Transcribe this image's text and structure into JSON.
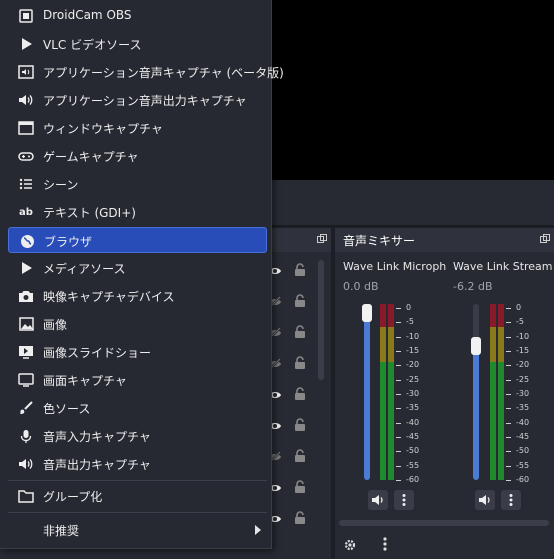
{
  "menu": {
    "items": [
      {
        "label": "DroidCam OBS",
        "icon": "droidcam-icon"
      },
      {
        "label": "VLC ビデオソース",
        "icon": "play-icon"
      },
      {
        "label": "アプリケーション音声キャプチャ (ベータ版)",
        "icon": "app-audio-capture-icon"
      },
      {
        "label": "アプリケーション音声出力キャプチャ",
        "icon": "speaker-icon"
      },
      {
        "label": "ウィンドウキャプチャ",
        "icon": "window-icon"
      },
      {
        "label": "ゲームキャプチャ",
        "icon": "gamepad-icon"
      },
      {
        "label": "シーン",
        "icon": "list-icon"
      },
      {
        "label": "テキスト (GDI+)",
        "icon": "text-icon"
      },
      {
        "label": "ブラウザ",
        "icon": "globe-icon"
      },
      {
        "label": "メディアソース",
        "icon": "play-icon"
      },
      {
        "label": "映像キャプチャデバイス",
        "icon": "camera-icon"
      },
      {
        "label": "画像",
        "icon": "image-icon"
      },
      {
        "label": "画像スライドショー",
        "icon": "slideshow-icon"
      },
      {
        "label": "画面キャプチャ",
        "icon": "monitor-icon"
      },
      {
        "label": "色ソース",
        "icon": "brush-icon"
      },
      {
        "label": "音声入力キャプチャ",
        "icon": "microphone-icon"
      },
      {
        "label": "音声出力キャプチャ",
        "icon": "speaker-icon"
      }
    ],
    "group": {
      "label": "グループ化",
      "icon": "folder-icon"
    },
    "deprecated": {
      "label": "非推奨"
    },
    "selected": "ブラウザ"
  },
  "mixer": {
    "title": "音声ミキサー",
    "channels": [
      {
        "name": "Wave Link Microph",
        "db": "0.0 dB",
        "level": 1.0
      },
      {
        "name": "Wave Link Stream",
        "db": "-6.2 dB",
        "level": 0.79
      }
    ],
    "meter_ticks": [
      "0",
      "-5",
      "-10",
      "-15",
      "-20",
      "-25",
      "-30",
      "-35",
      "-40",
      "-45",
      "-50",
      "-55",
      "-60"
    ]
  },
  "sources": {
    "rows": [
      {
        "visible": true,
        "locked": false
      },
      {
        "visible": false,
        "locked": false
      },
      {
        "visible": false,
        "locked": false
      },
      {
        "visible": false,
        "locked": false
      },
      {
        "visible": true,
        "locked": false
      },
      {
        "visible": true,
        "locked": false
      },
      {
        "visible": false,
        "locked": false
      },
      {
        "visible": true,
        "locked": false
      },
      {
        "visible": true,
        "locked": false
      }
    ]
  },
  "colors": {
    "accent": "#284cb8",
    "meter_green": "#1f8a2e",
    "meter_yellow": "#8a7a1a",
    "meter_red": "#8a1a2a",
    "slider": "#4b7bd4"
  }
}
